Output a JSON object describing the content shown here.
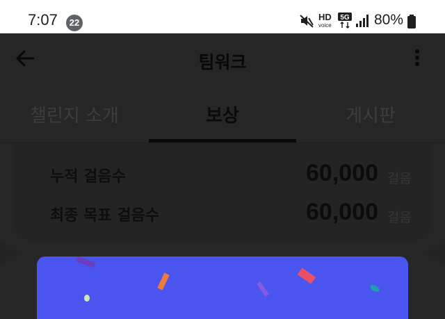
{
  "status_bar": {
    "time": "7:07",
    "notification_count": "22",
    "hd_label": "HD",
    "hd_sub": "voice",
    "network": "5G",
    "battery": "80%"
  },
  "app_bar": {
    "title": "팀워크",
    "back_icon": "arrow-left-icon",
    "menu_icon": "more-vertical-icon"
  },
  "tabs": [
    {
      "label": "챌린지 소개",
      "selected": false
    },
    {
      "label": "보상",
      "selected": true
    },
    {
      "label": "게시판",
      "selected": false
    }
  ],
  "rewards": {
    "rows": [
      {
        "label": "누적 걸음수",
        "value": "60,000",
        "unit": "걸음"
      },
      {
        "label": "최종 목표 걸음수",
        "value": "60,000",
        "unit": "걸음"
      }
    ]
  },
  "colors": {
    "banner": "#4a55f0",
    "background": "#262626"
  }
}
